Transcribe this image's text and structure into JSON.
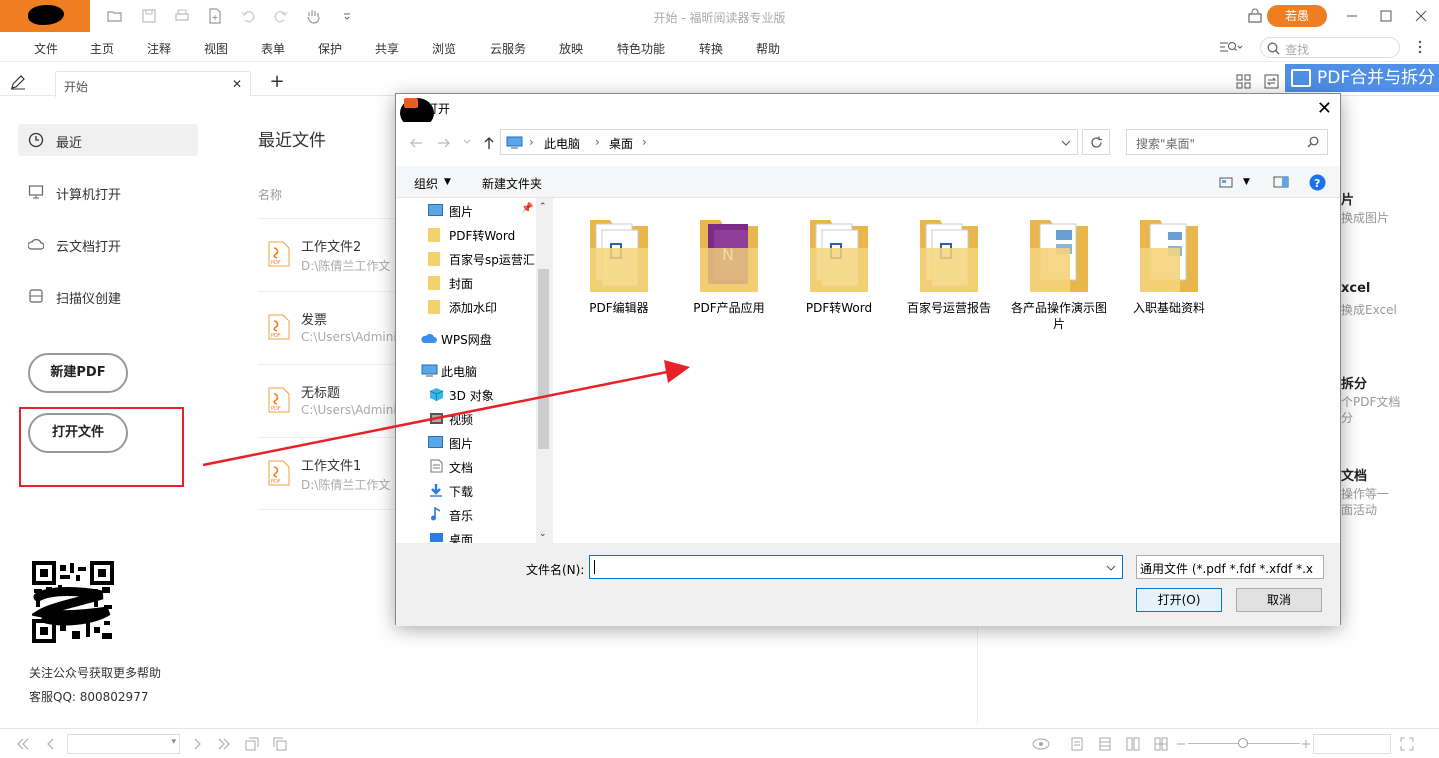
{
  "app": {
    "title": "开始 - 福昕阅读器专业版",
    "user_button": "若愚"
  },
  "menu": [
    "文件",
    "主页",
    "注释",
    "视图",
    "表单",
    "保护",
    "共享",
    "浏览",
    "云服务",
    "放映",
    "特色功能",
    "转换",
    "帮助"
  ],
  "search": {
    "placeholder": "查找"
  },
  "tabs": [
    {
      "label": "开始"
    }
  ],
  "banner": {
    "label": "PDF合并与拆分"
  },
  "left_nav": {
    "items": [
      {
        "label": "最近",
        "icon": "clock-icon",
        "selected": true
      },
      {
        "label": "计算机打开",
        "icon": "computer-icon"
      },
      {
        "label": "云文档打开",
        "icon": "cloud-icon"
      },
      {
        "label": "扫描仪创建",
        "icon": "scanner-icon"
      }
    ],
    "new_pdf": "新建PDF",
    "open_file": "打开文件",
    "help_text": "关注公众号获取更多帮助",
    "qq_text": "客服QQ: 800802977"
  },
  "recent": {
    "title": "最近文件",
    "column_name": "名称",
    "files": [
      {
        "name": "工作文件2",
        "path": "D:\\陈倩兰工作文"
      },
      {
        "name": "发票",
        "path": "C:\\Users\\Admini"
      },
      {
        "name": "无标题",
        "path": "C:\\Users\\Admini"
      },
      {
        "name": "工作文件1",
        "path": "D:\\陈倩兰工作文"
      }
    ]
  },
  "right_peek": [
    {
      "title": "片",
      "desc": "换成图片"
    },
    {
      "title": "xcel",
      "desc": "换成Excel"
    },
    {
      "title": "拆分",
      "desc": "个PDF文档",
      "desc2": "分"
    },
    {
      "title": "文档",
      "desc": "操作等一",
      "desc2": "面活动"
    }
  ],
  "dialog": {
    "title": "打开",
    "breadcrumb": [
      "此电脑",
      "桌面"
    ],
    "search_placeholder": "搜索\"桌面\"",
    "toolbar": {
      "organize": "组织",
      "new_folder": "新建文件夹"
    },
    "nav": [
      {
        "label": "图片",
        "icon": "pictures-icon"
      },
      {
        "label": "PDF转Word",
        "icon": "folder-icon"
      },
      {
        "label": "百家号sp运营汇",
        "icon": "folder-icon"
      },
      {
        "label": "封面",
        "icon": "folder-icon"
      },
      {
        "label": "添加水印",
        "icon": "folder-icon"
      },
      {
        "label": "WPS网盘",
        "icon": "cloud-icon"
      },
      {
        "label": "此电脑",
        "icon": "computer-icon"
      },
      {
        "label": "3D 对象",
        "icon": "cube-icon"
      },
      {
        "label": "视频",
        "icon": "video-icon"
      },
      {
        "label": "图片",
        "icon": "pictures-icon"
      },
      {
        "label": "文档",
        "icon": "document-icon"
      },
      {
        "label": "下载",
        "icon": "download-icon"
      },
      {
        "label": "音乐",
        "icon": "music-icon"
      },
      {
        "label": "桌面",
        "icon": "desktop-icon",
        "selected": true
      }
    ],
    "files": [
      {
        "name": "PDF编辑器",
        "style": "doc"
      },
      {
        "name": "PDF产品应用",
        "style": "onenote"
      },
      {
        "name": "PDF转Word",
        "style": "doc"
      },
      {
        "name": "百家号运营报告",
        "style": "doc"
      },
      {
        "name": "各产品操作演示图片",
        "style": "img"
      },
      {
        "name": "入职基础资料",
        "style": "img"
      }
    ],
    "filename_label": "文件名(N):",
    "filename_value": "",
    "filetype": "通用文件 (*.pdf *.fdf *.xfdf *.x",
    "open_button": "打开(O)",
    "cancel_button": "取消"
  },
  "colors": {
    "accent": "#ef7d22",
    "highlight": "#e8202a",
    "banner": "#4f8fe6",
    "selection": "#cce8ff"
  }
}
